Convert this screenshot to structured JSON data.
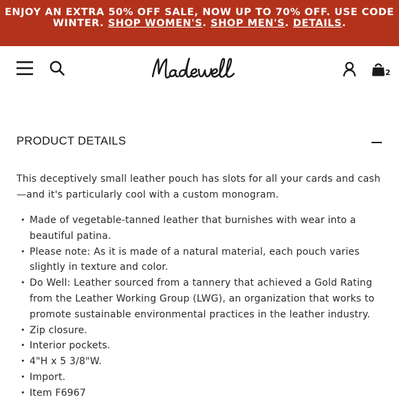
{
  "promo": {
    "line1": "ENJOY AN EXTRA 50% OFF SALE, NOW UP TO 70% OFF. USE CODE",
    "code_text": "WINTER.",
    "link_womens": "SHOP WOMEN'S",
    "link_mens": "SHOP MEN'S",
    "link_details": "DETAILS",
    "separator": ".",
    "background_color": "#b3321c"
  },
  "header": {
    "logo_text": "Madewell",
    "icons": [
      "menu-icon",
      "search-icon",
      "account-icon",
      "bag-icon"
    ],
    "bag_count": "2"
  },
  "product_details": {
    "title": "PRODUCT DETAILS",
    "toggle_symbol": "collapse (minus) icon",
    "description": "This deceptively small leather pouch has slots for all your cards and cash—and it's particularly cool with a custom monogram.",
    "bullets": [
      "Made of vegetable-tanned leather that burnishes with wear into a beautiful patina.",
      "Please note: As it is made of a natural material, each pouch varies slightly in texture and color.",
      "Do Well: Leather sourced from a tannery that achieved a Gold Rating from the Leather Working Group (LWG), an organization that works to promote sustainable environmental practices in the leather industry.",
      "Zip closure.",
      "Interior pockets.",
      "4\"H x 5 3/8\"W.",
      "Import.",
      "Item F6967"
    ]
  }
}
